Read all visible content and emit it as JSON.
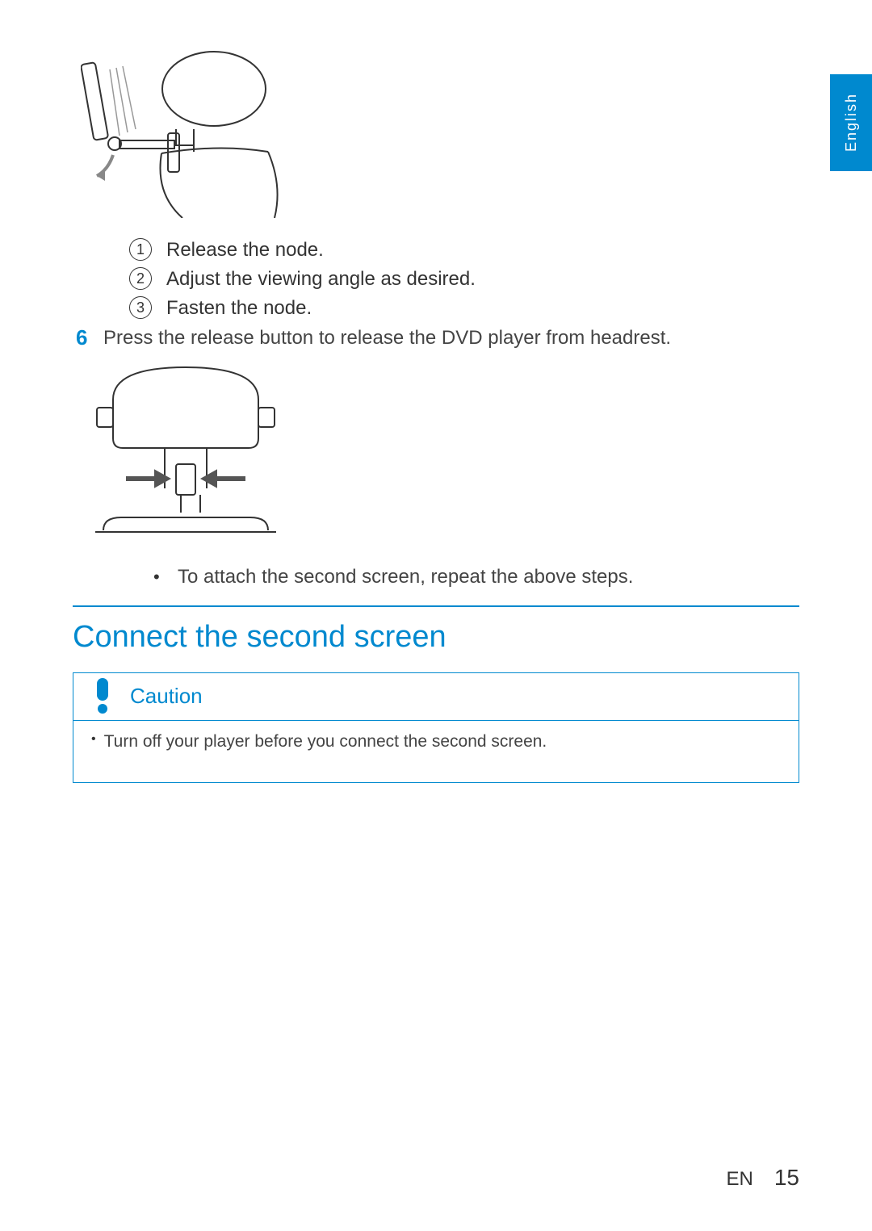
{
  "language_tab": "English",
  "substeps": [
    {
      "num": "1",
      "text": "Release the node."
    },
    {
      "num": "2",
      "text": "Adjust the viewing angle as desired."
    },
    {
      "num": "3",
      "text": "Fasten the node."
    }
  ],
  "main_step_num": "6",
  "main_step_text": "Press the release button to release the DVD player from headrest.",
  "bullet_note": "To attach the second screen, repeat the above steps.",
  "section_heading": "Connect the second screen",
  "callout": {
    "title": "Caution",
    "text": "Turn off your player before you connect the second screen."
  },
  "footer": {
    "lang": "EN",
    "page": "15"
  }
}
